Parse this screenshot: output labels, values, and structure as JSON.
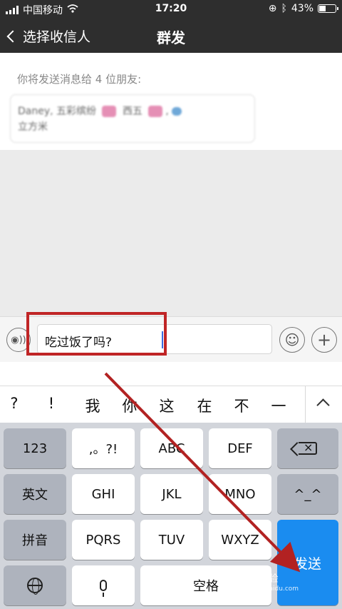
{
  "status_bar": {
    "carrier": "中国移动",
    "time": "17:20",
    "battery": "43%"
  },
  "nav": {
    "back_label": "选择收信人",
    "title": "群发"
  },
  "recipients": {
    "hint": "你将发送消息给 4 位朋友:",
    "names_line1": "Daney, 五彩缤纷",
    "name_b": "西五",
    "names_line2": "立方米"
  },
  "composer": {
    "text": "吃过饭了吗?"
  },
  "suggestions": [
    "?",
    "!",
    "我",
    "你",
    "这",
    "在",
    "不",
    "一"
  ],
  "keyboard": {
    "row1": [
      "123",
      ",。?!",
      "ABC",
      "DEF"
    ],
    "row2": [
      "英文",
      "GHI",
      "JKL",
      "MNO",
      "^_^"
    ],
    "row3": [
      "拼音",
      "PQRS",
      "TUV",
      "WXYZ"
    ],
    "send": "发送",
    "space": "空格"
  },
  "colors": {
    "highlight": "#c02526",
    "send_key": "#1a8cf0",
    "arrow": "#b22222"
  },
  "watermark": {
    "brand": "Bai 经验",
    "url": "jingyan.baidu.com"
  }
}
